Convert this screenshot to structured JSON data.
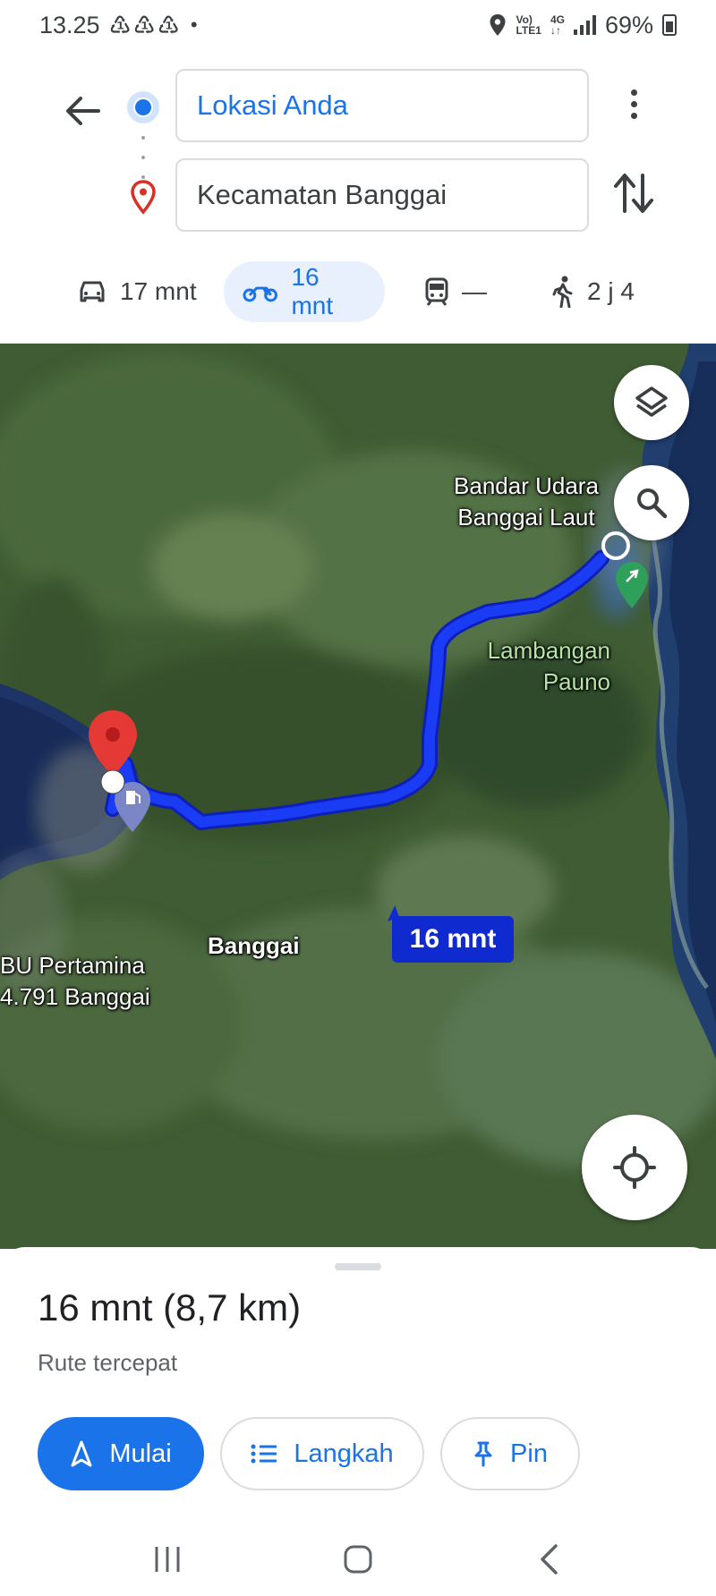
{
  "status_bar": {
    "time": "13.25",
    "notification_icons": "♳♳♳",
    "dot": "•",
    "network_top": "Vo)",
    "network_bottom": "LTE1",
    "network_type_top": "4G",
    "network_type_bottom": "↓↑",
    "battery_percent": "69%"
  },
  "directions": {
    "origin_text": "Lokasi Anda",
    "destination_text": "Kecamatan Banggai"
  },
  "travel_modes": [
    {
      "name": "car",
      "duration": "17 mnt"
    },
    {
      "name": "motorcycle",
      "duration": "16 mnt",
      "selected": true
    },
    {
      "name": "transit",
      "duration": "—"
    },
    {
      "name": "walk",
      "duration": "2 j 4"
    }
  ],
  "map": {
    "labels": {
      "airport_line1": "Bandar Udara",
      "airport_line2": "Banggai Laut",
      "place_line1": "Lambangan",
      "place_line2": "Pauno",
      "town": "Banggai",
      "fuel_line1": "BU Pertamina",
      "fuel_line2": "4.791 Banggai"
    },
    "route_eta": "16 mnt",
    "route_color": "#1a3cf5"
  },
  "sheet": {
    "title": "16 mnt (8,7 km)",
    "subtitle": "Rute tercepat",
    "start_label": "Mulai",
    "steps_label": "Langkah",
    "pin_label": "Pin"
  },
  "colors": {
    "accent": "#1a73e8",
    "destination_pin": "#d93025"
  }
}
